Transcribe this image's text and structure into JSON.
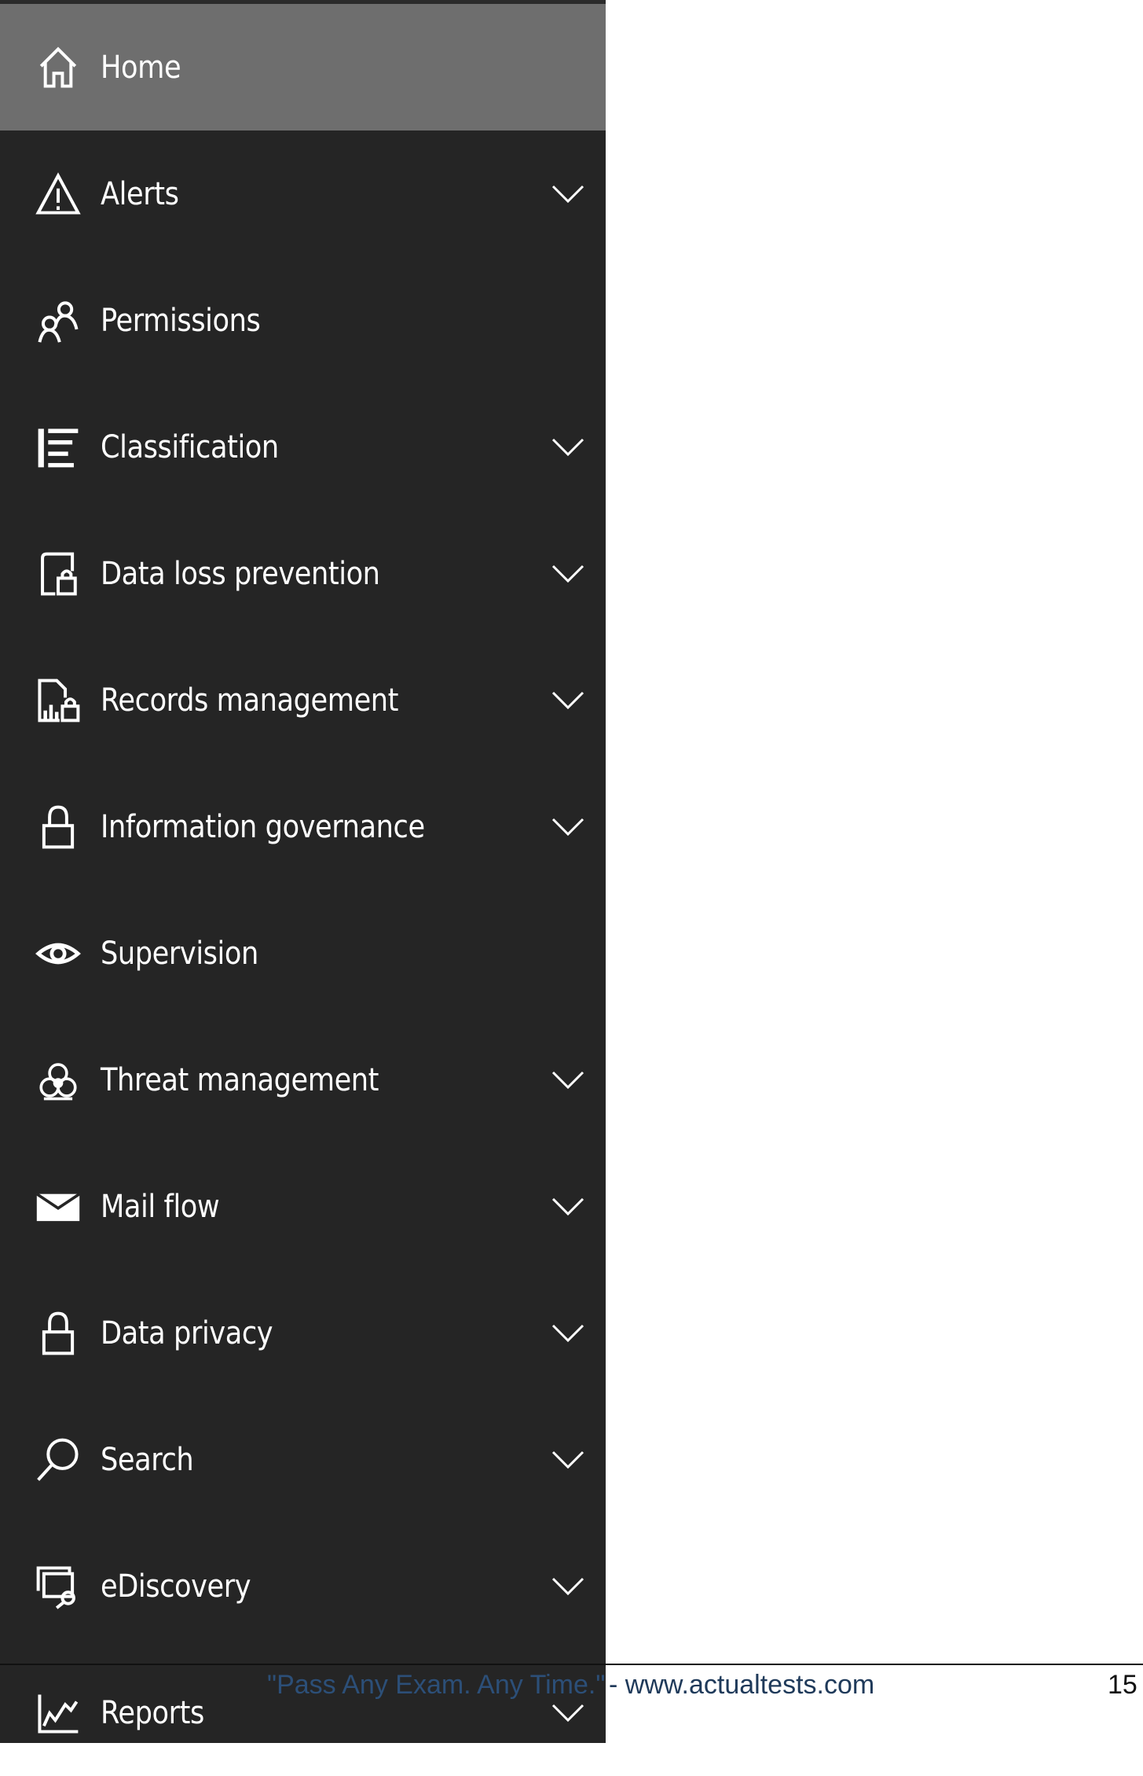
{
  "sidebar": {
    "active_item": "Home",
    "items": [
      {
        "label": "Home",
        "icon": "home-icon",
        "expandable": false,
        "active": true
      },
      {
        "label": "Alerts",
        "icon": "warning-icon",
        "expandable": true
      },
      {
        "label": "Permissions",
        "icon": "people-icon",
        "expandable": false
      },
      {
        "label": "Classification",
        "icon": "list-icon",
        "expandable": true
      },
      {
        "label": "Data loss prevention",
        "icon": "document-lock-icon",
        "expandable": true
      },
      {
        "label": "Records management",
        "icon": "records-lock-icon",
        "expandable": true
      },
      {
        "label": "Information governance",
        "icon": "lock-icon",
        "expandable": true
      },
      {
        "label": "Supervision",
        "icon": "eye-icon",
        "expandable": false
      },
      {
        "label": "Threat management",
        "icon": "biohazard-icon",
        "expandable": true
      },
      {
        "label": "Mail flow",
        "icon": "mail-icon",
        "expandable": true
      },
      {
        "label": "Data privacy",
        "icon": "lock-icon",
        "expandable": true
      },
      {
        "label": "Search",
        "icon": "search-icon",
        "expandable": true
      },
      {
        "label": "eDiscovery",
        "icon": "ediscovery-icon",
        "expandable": true
      },
      {
        "label": "Reports",
        "icon": "chart-line-icon",
        "expandable": true
      }
    ]
  },
  "footer": {
    "quote": "\"Pass Any Exam. Any Time.\"",
    "site": "- www.actualtests.com",
    "page_number": "15"
  },
  "colors": {
    "sidebar_bg": "#252525",
    "active_bg": "#6e6e6e",
    "text": "#ffffff",
    "footer_quote": "#2c4f78"
  }
}
